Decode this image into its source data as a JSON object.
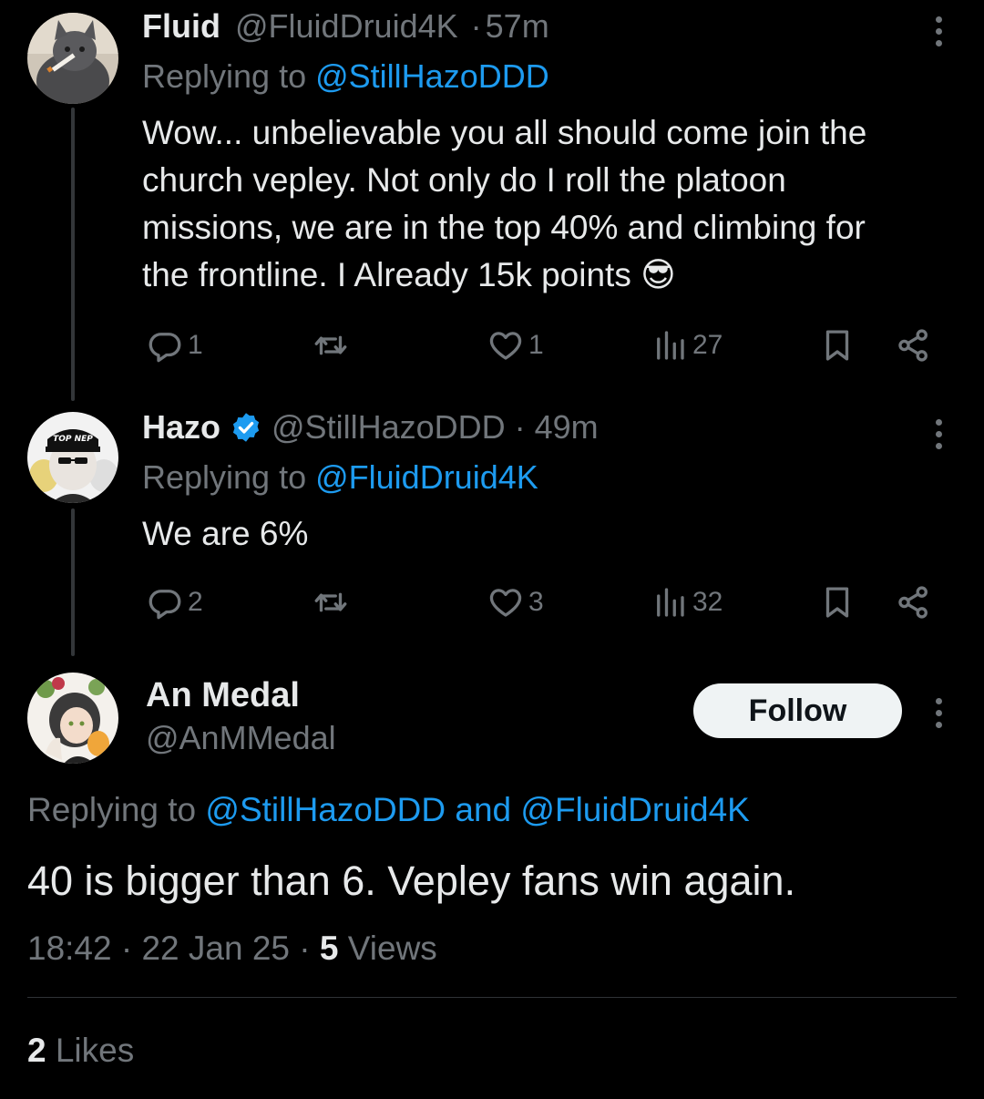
{
  "tweets": [
    {
      "display_name": "Fluid",
      "handle": "@FluidDruid4K",
      "separator": "·",
      "time": "57m",
      "replying_prefix": "Replying to",
      "replying_to": "@StillHazoDDD",
      "text_lines": [
        "Wow... unbelievable you all should come join the",
        "church vepley. Not only do I roll the platoon",
        "missions, we are in the top 40% and climbing for",
        "the frontline. I Already 15k points 😎"
      ],
      "replies": "1",
      "reposts": "",
      "likes": "1",
      "views": "27"
    },
    {
      "display_name": "Hazo",
      "verified": true,
      "handle": "@StillHazoDDD",
      "separator": "·",
      "time": "49m",
      "replying_prefix": "Replying to",
      "replying_to": "@FluidDruid4K",
      "text": "We are 6%",
      "replies": "2",
      "reposts": "",
      "likes": "3",
      "views": "32"
    }
  ],
  "focused": {
    "display_name": "An Medal",
    "handle": "@AnMMedal",
    "follow_label": "Follow",
    "replying_prefix": "Replying to",
    "replying_to_1": "@StillHazoDDD",
    "conjunction": "and",
    "replying_to_2": "@FluidDruid4K",
    "text": "40 is bigger than 6. Vepley fans win again.",
    "timestamp_time": "18:42",
    "separator": "·",
    "timestamp_date": "22 Jan 25",
    "views_count": "5",
    "views_label": "Views",
    "likes_count": "2",
    "likes_label": "Likes"
  },
  "avatar_texts": {
    "hazo_cap": "TOP NEP"
  },
  "colors": {
    "background": "#000000",
    "text_primary": "#e7e9ea",
    "text_secondary": "#71767b",
    "link": "#1d9bf0",
    "verified_badge": "#1d9bf0",
    "follow_button_bg": "#eff3f4"
  },
  "icons": {
    "reply": "reply-icon",
    "repost": "repost-icon",
    "like": "heart-icon",
    "views": "views-icon",
    "bookmark": "bookmark-icon",
    "share": "share-icon",
    "more": "more-vertical-icon",
    "verified": "verified-badge-icon"
  }
}
